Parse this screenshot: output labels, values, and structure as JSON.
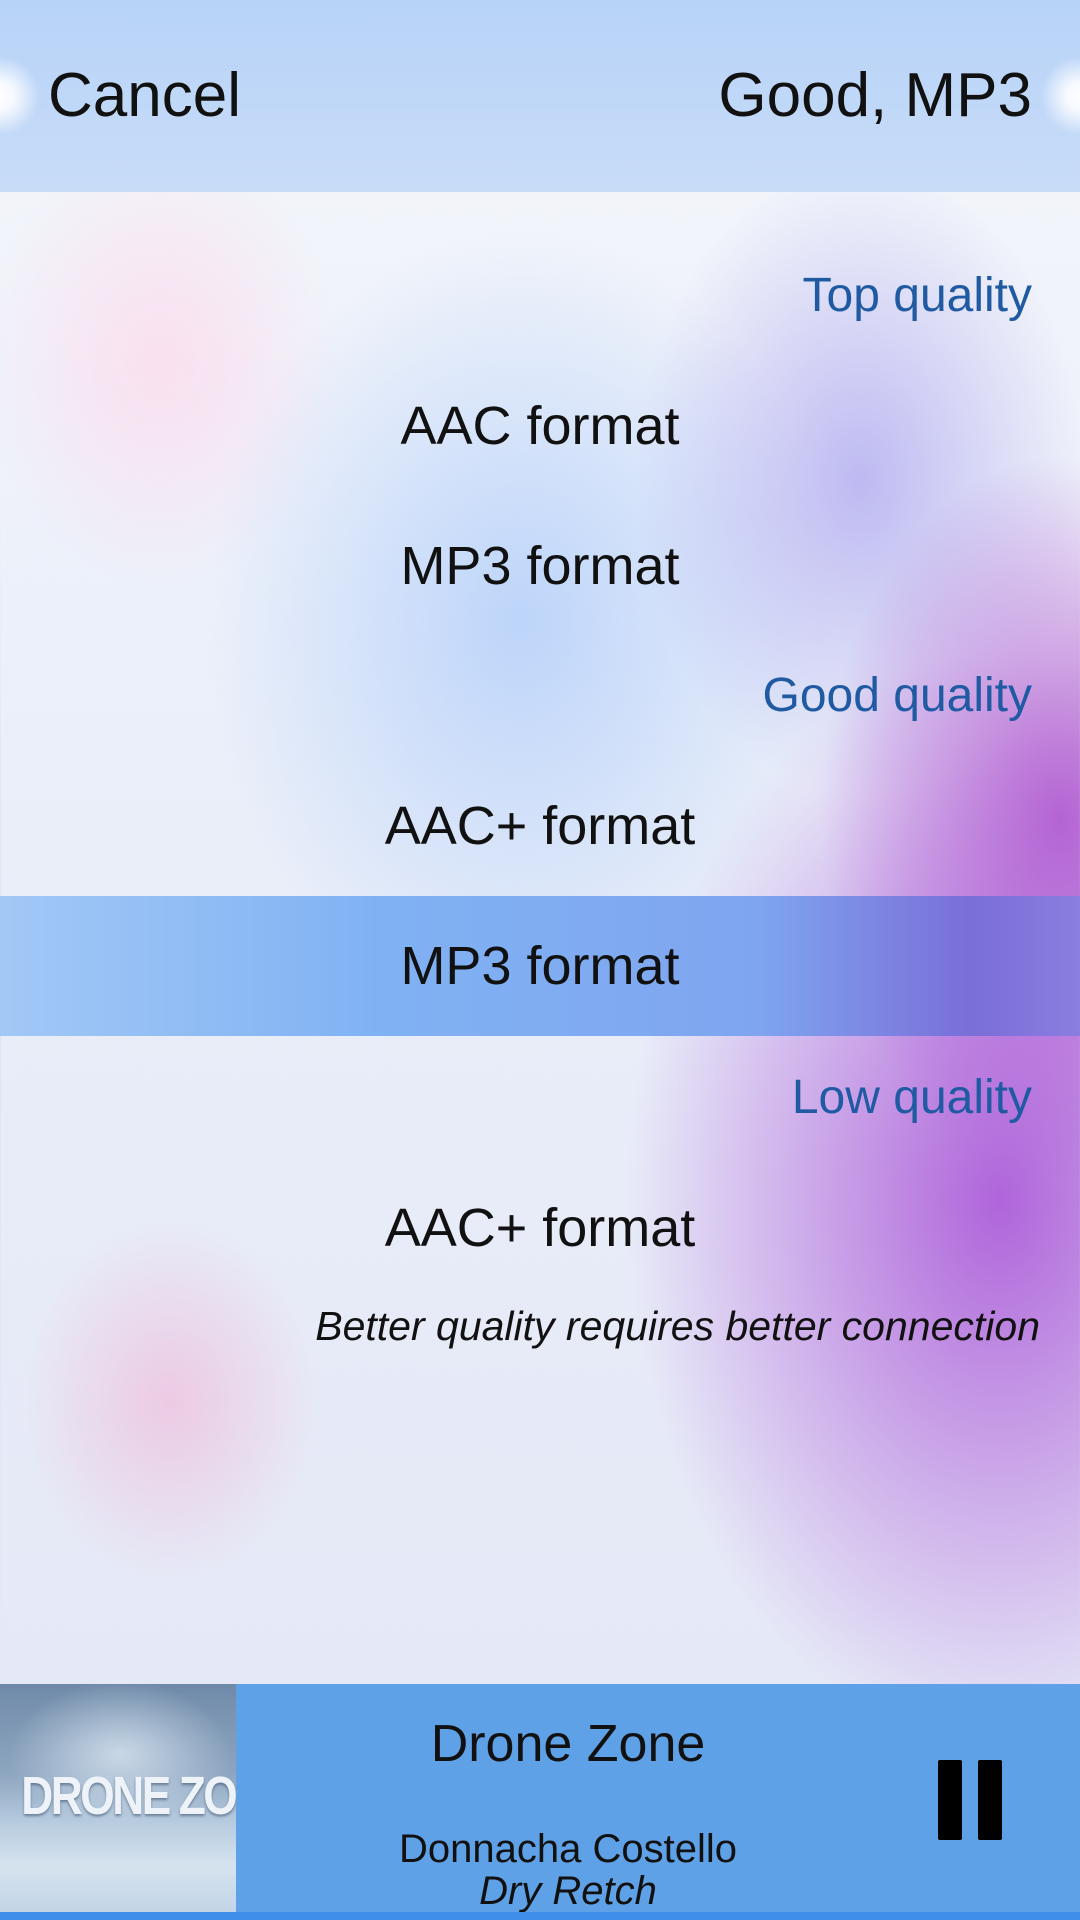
{
  "header": {
    "cancel_label": "Cancel",
    "accept_label": "Good, MP3"
  },
  "sections": [
    {
      "title": "Top quality",
      "options": [
        {
          "label": "AAC format",
          "selected": false
        },
        {
          "label": "MP3 format",
          "selected": false
        }
      ]
    },
    {
      "title": "Good quality",
      "options": [
        {
          "label": "AAC+ format",
          "selected": false
        },
        {
          "label": "MP3 format",
          "selected": true
        }
      ]
    },
    {
      "title": "Low quality",
      "options": [
        {
          "label": "AAC+ format",
          "selected": false
        }
      ]
    }
  ],
  "note": "Better quality requires better connection",
  "player": {
    "cover_text": "DRONE ZONE",
    "title": "Drone Zone",
    "artist": "Donnacha Costello",
    "album": "Dry Retch",
    "pause_icon": "pause-icon"
  },
  "colors": {
    "accent": "#1f5aa3",
    "selected_row": "#80b2f3",
    "player_bg": "#5fa1e6",
    "header_bg": "#b7d3f8"
  }
}
